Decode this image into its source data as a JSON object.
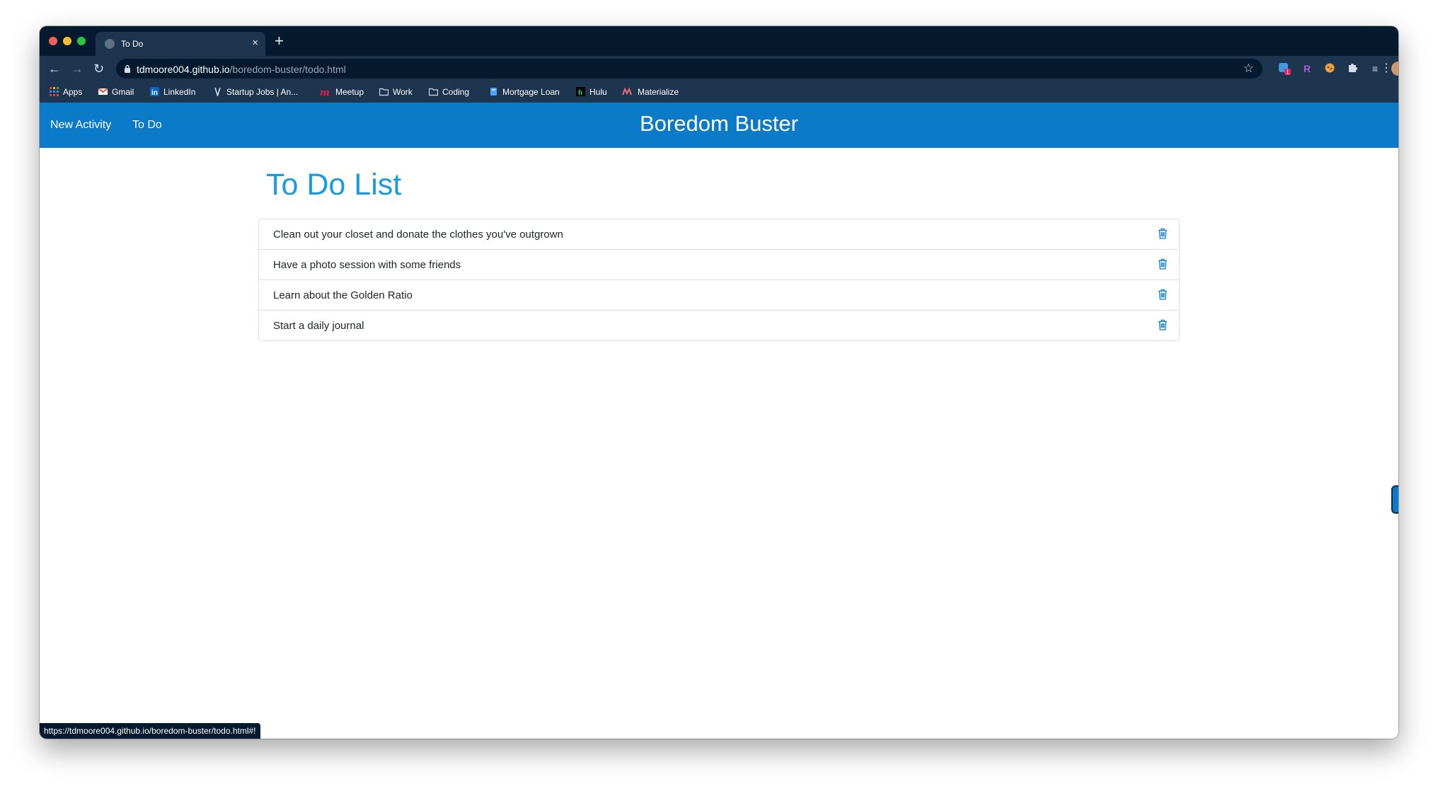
{
  "browser": {
    "tab_title": "To Do",
    "tab_close": "×",
    "new_tab": "+",
    "url_host": "tdmoore004.github.io",
    "url_path": "/boredom-buster/todo.html",
    "status_url": "https://tdmoore004.github.io/boredom-buster/todo.html#!",
    "bookmarks": [
      {
        "label": "Apps",
        "icon": "apps-grid-icon"
      },
      {
        "label": "Gmail",
        "icon": "gmail-icon"
      },
      {
        "label": "LinkedIn",
        "icon": "linkedin-icon"
      },
      {
        "label": "Startup Jobs | An...",
        "icon": "startup-jobs-icon"
      },
      {
        "label": "Meetup",
        "icon": "meetup-icon"
      },
      {
        "label": "Work",
        "icon": "folder-icon"
      },
      {
        "label": "Coding",
        "icon": "folder-icon"
      },
      {
        "label": "Mortgage Loan",
        "icon": "bookmark-page-icon"
      },
      {
        "label": "Hulu",
        "icon": "hulu-icon"
      },
      {
        "label": "Materialize",
        "icon": "materialize-icon"
      }
    ],
    "ext_badge": "1"
  },
  "app": {
    "brand": "Boredom Buster",
    "nav_links": [
      "New Activity",
      "To Do"
    ],
    "page_title": "To Do List",
    "todos": [
      "Clean out your closet and donate the clothes you've outgrown",
      "Have a photo session with some friends",
      "Learn about the Golden Ratio",
      "Start a daily journal"
    ]
  },
  "colors": {
    "navbar": "#0b7ac9",
    "title": "#1a9bdf",
    "browser_dark": "#061a2f",
    "browser_chrome": "#1e3550"
  }
}
